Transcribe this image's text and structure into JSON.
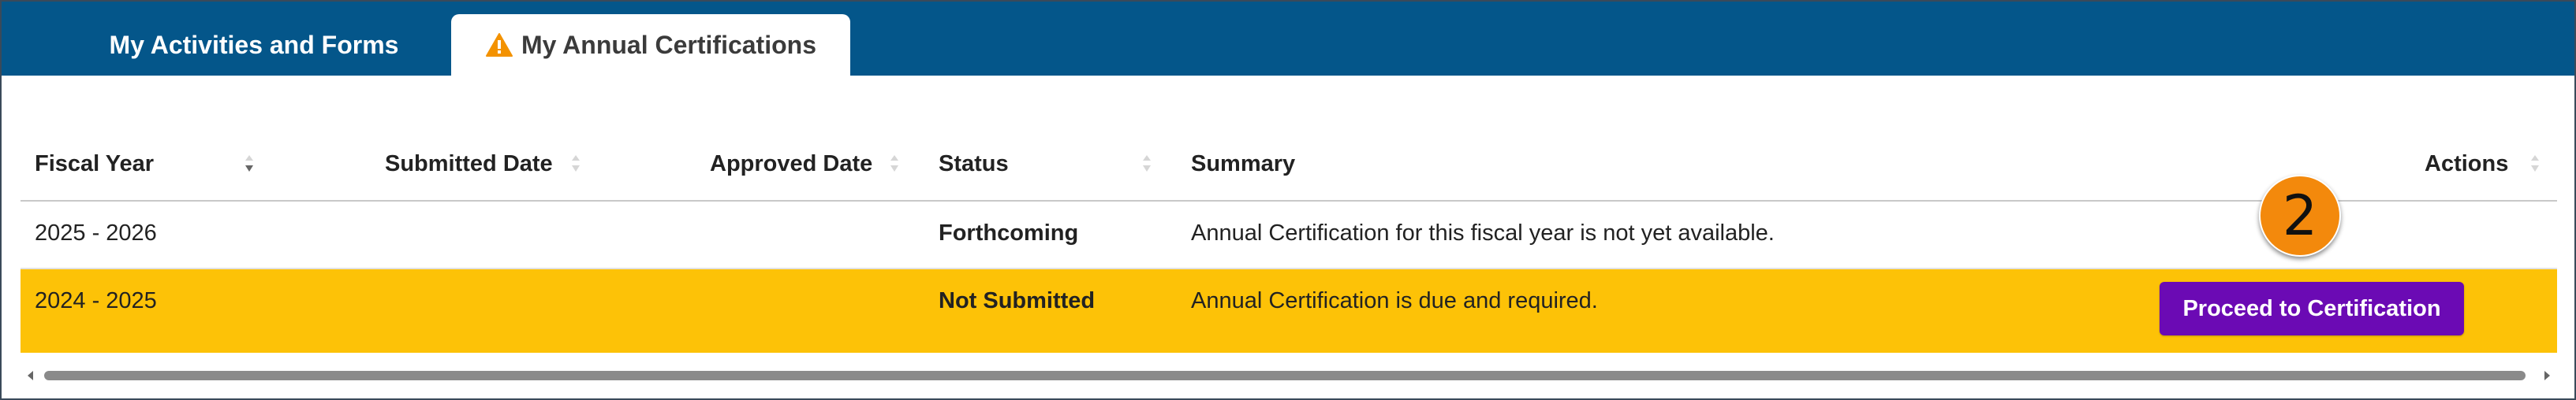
{
  "tabs": [
    {
      "label": "My Activities and Forms",
      "active": false
    },
    {
      "label": "My Annual Certifications",
      "active": true,
      "icon": "warning-icon"
    }
  ],
  "table": {
    "columns": [
      "Fiscal Year",
      "Submitted Date",
      "Approved Date",
      "Status",
      "Summary",
      "Actions"
    ],
    "rows": [
      {
        "fiscal_year": "2025 - 2026",
        "submitted_date": "",
        "approved_date": "",
        "status": "Forthcoming",
        "summary": "Annual Certification for this fiscal year is not yet available.",
        "action": ""
      },
      {
        "fiscal_year": "2024 - 2025",
        "submitted_date": "",
        "approved_date": "",
        "status": "Not Submitted",
        "summary": "Annual Certification is due and required.",
        "action": "Proceed to Certification",
        "highlighted": true
      }
    ]
  },
  "callout": {
    "label": "2"
  },
  "colors": {
    "header_bg": "#04568a",
    "highlight_row": "#fdc207",
    "button_bg": "#6b0ab4",
    "callout_bg": "#f3890c",
    "warning_icon": "#f39200"
  }
}
